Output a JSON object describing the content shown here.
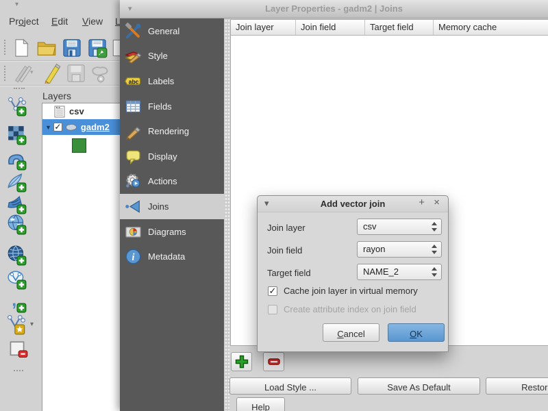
{
  "main_window": {
    "overflow_arrow": "▾",
    "menubar": [
      {
        "pre": "Pr",
        "key": "o",
        "post": "ject"
      },
      {
        "pre": "",
        "key": "E",
        "post": "dit"
      },
      {
        "pre": "",
        "key": "V",
        "post": "iew"
      },
      {
        "pre": "",
        "key": "L",
        "post": "a"
      }
    ],
    "layers_panel": {
      "title": "Layers",
      "rows": [
        {
          "label": "csv",
          "type": "table-layer"
        },
        {
          "label": "gadm2",
          "type": "polygon-layer",
          "selected": true,
          "checked": true
        }
      ],
      "symbol_color": "#3a8f3a"
    }
  },
  "layer_properties": {
    "title": "Layer Properties - gadm2 | Joins",
    "titlebar_arrow": "▾",
    "sidebar": {
      "selected": "Joins",
      "items": [
        {
          "label": "General"
        },
        {
          "label": "Style"
        },
        {
          "label": "Labels"
        },
        {
          "label": "Fields"
        },
        {
          "label": "Rendering"
        },
        {
          "label": "Display"
        },
        {
          "label": "Actions"
        },
        {
          "label": "Joins",
          "selected": true
        },
        {
          "label": "Diagrams"
        },
        {
          "label": "Metadata"
        }
      ]
    },
    "join_table": {
      "columns": [
        "Join layer",
        "Join field",
        "Target field",
        "Memory cache"
      ],
      "rows": []
    },
    "buttons": {
      "load_style": "Load Style ...",
      "save_as_default": "Save As Default",
      "restore_default": "Restore De",
      "help": "Help"
    }
  },
  "add_vector_join": {
    "title": "Add vector join",
    "titlebar": {
      "menu_arrow": "▾",
      "shade_button": "+",
      "close_button": "×"
    },
    "fields": [
      {
        "label": "Join layer",
        "value": "csv"
      },
      {
        "label": "Join field",
        "value": "rayon"
      },
      {
        "label": "Target field",
        "value": "NAME_2"
      }
    ],
    "checkboxes": [
      {
        "label": "Cache join layer in virtual memory",
        "checked": true,
        "enabled": true
      },
      {
        "label": "Create attribute index on join field",
        "checked": false,
        "enabled": false
      }
    ],
    "buttons": {
      "cancel": {
        "pre": "",
        "key": "C",
        "post": "ancel"
      },
      "ok": {
        "pre": "",
        "key": "O",
        "post": "K"
      }
    }
  },
  "icons": {
    "expand_arrow": "▼",
    "dropdown_arrow": "▾",
    "check_glyph": "✓",
    "labels_icon_text": "abc",
    "metadata_icon_text": "i",
    "comma_icon_text": ",",
    "left_toolbar": [
      "add-vector-layer",
      "add-raster-layer",
      "add-postgis-layer",
      "add-spatialite-layer",
      "add-mssql-layer",
      "add-wms-layer",
      "add-wcs-layer",
      "add-wfs-layer",
      "add-delimited-text-layer",
      "new-shapefile-layer",
      "remove-layer"
    ],
    "top_toolbar": [
      "new-project",
      "open-project",
      "save-project",
      "save-project-as"
    ],
    "edit_toolbar": [
      "current-edits",
      "toggle-editing",
      "save-edits",
      "select-features"
    ]
  },
  "colors": {
    "selection_blue": "#4a90d9",
    "sidebar_dark": "#585858",
    "sidebar_selected": "#cfcfcf",
    "ok_button_blue": "#5a97cf",
    "add_green": "#2aa02a",
    "remove_red": "#c83232",
    "symbol_green": "#3a8f3a"
  }
}
